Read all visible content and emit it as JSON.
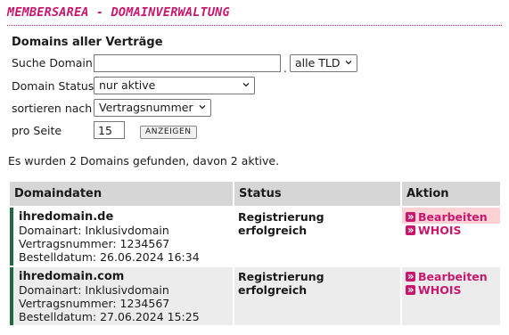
{
  "header": {
    "title": "MEMBERSAREA - DOMAINVERWALTUNG"
  },
  "filter": {
    "heading": "Domains aller Verträge",
    "search_label": "Suche Domain",
    "search_value": "",
    "tld_selected": "alle TLD",
    "status_label": "Domain Status",
    "status_selected": "nur aktive",
    "sort_label": "sortieren nach",
    "sort_selected": "Vertragsnummer",
    "per_page_label": "pro Seite",
    "per_page_value": "15",
    "submit_label": "ANZEIGEN"
  },
  "result_text": "Es wurden 2 Domains gefunden, davon 2 aktive.",
  "table": {
    "headers": [
      "Domaindaten",
      "Status",
      "Aktion"
    ],
    "rows": [
      {
        "domain": "ihredomain.de",
        "art": "Domainart: Inklusivdomain",
        "vertrag": "Vertragsnummer: 1234567",
        "datum": "Bestelldatum: 26.06.2024 16:34",
        "status": "Registrierung erfolgreich",
        "edit": "Bearbeiten",
        "whois": "WHOIS"
      },
      {
        "domain": "ihredomain.com",
        "art": "Domainart: Inklusivdomain",
        "vertrag": "Vertragsnummer: 1234567",
        "datum": "Bestelldatum: 27.06.2024 15:25",
        "status": "Registrierung erfolgreich",
        "edit": "Bearbeiten",
        "whois": "WHOIS"
      }
    ]
  },
  "colors": {
    "accent": "#c8186e",
    "row_marker": "#1f6b3f",
    "header_bg": "#d6d6d6",
    "highlight": "#ffd0d4"
  }
}
